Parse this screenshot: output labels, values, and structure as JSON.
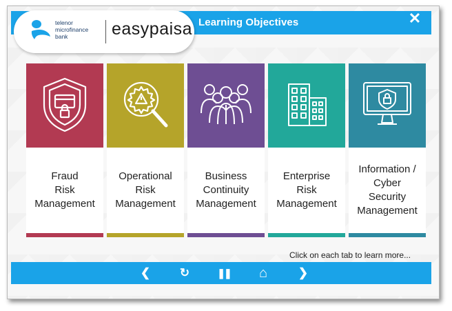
{
  "header": {
    "title": "Learning Objectives",
    "close_label": "✕",
    "logo": {
      "bank_lines": [
        "telenor",
        "microfinance",
        "bank"
      ],
      "brand": "easypaisa"
    }
  },
  "tabs": [
    {
      "id": "fraud",
      "label": "Fraud\nRisk\nManagement",
      "color": "#b23a52",
      "icon": "shield-card-icon"
    },
    {
      "id": "operational",
      "label": "Operational\nRisk\nManagement",
      "color": "#b5a42a",
      "icon": "gear-magnifier-icon"
    },
    {
      "id": "business",
      "label": "Business\nContinuity\nManagement",
      "color": "#6e4e93",
      "icon": "team-people-icon"
    },
    {
      "id": "enterprise",
      "label": "Enterprise\nRisk\nManagement",
      "color": "#22a89a",
      "icon": "buildings-icon"
    },
    {
      "id": "infosec",
      "label": "Information /\nCyber\nSecurity\nManagement",
      "color": "#2e8aa1",
      "icon": "monitor-lock-icon"
    }
  ],
  "hint": "Click on each tab to learn more...",
  "nav": {
    "prev": "❮",
    "replay": "↻",
    "pause": "❚❚",
    "home": "⌂",
    "next": "❯"
  },
  "colors": {
    "accent": "#1aa3e8"
  }
}
